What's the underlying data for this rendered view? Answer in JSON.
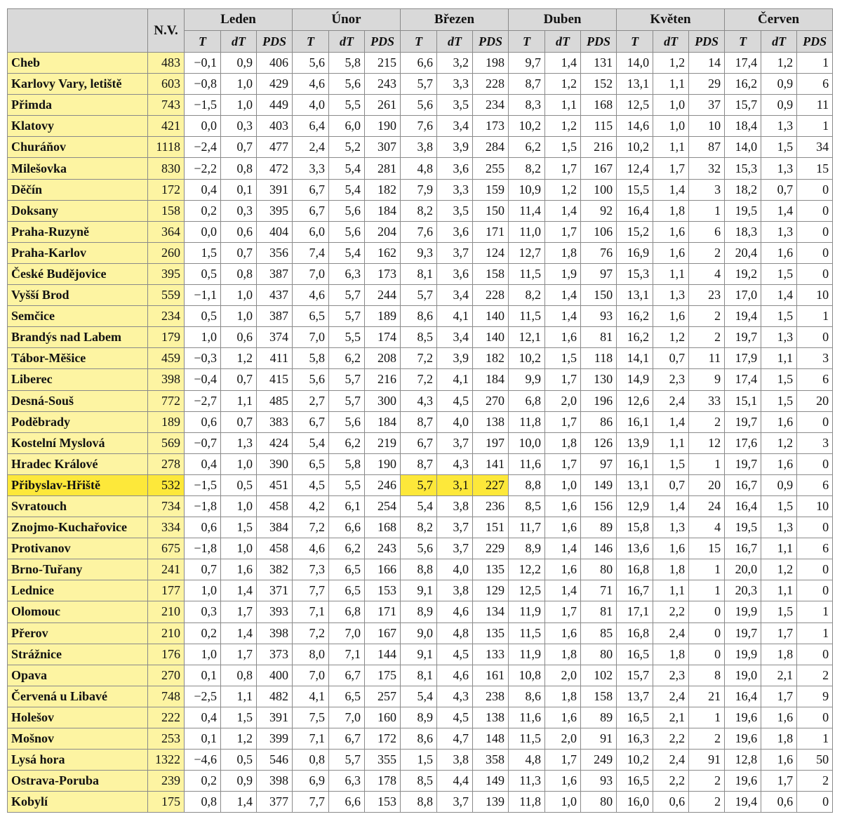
{
  "table": {
    "nv_header": "N.V.",
    "months": [
      "Leden",
      "Únor",
      "Březen",
      "Duben",
      "Květen",
      "Červen"
    ],
    "sub_headers": [
      "T",
      "dT",
      "PDS"
    ],
    "highlight": {
      "row": 20,
      "month_index": 2
    },
    "colors": {
      "station_bg": "#fdf4a2",
      "highlight_bg": "#fde83a",
      "header_bg": "#d9d9d9"
    },
    "rows": [
      [
        "Cheb",
        "483",
        "−0,1",
        "0,9",
        "406",
        "5,6",
        "5,8",
        "215",
        "6,6",
        "3,2",
        "198",
        "9,7",
        "1,4",
        "131",
        "14,0",
        "1,2",
        "14",
        "17,4",
        "1,2",
        "1"
      ],
      [
        "Karlovy Vary, letiště",
        "603",
        "−0,8",
        "1,0",
        "429",
        "4,6",
        "5,6",
        "243",
        "5,7",
        "3,3",
        "228",
        "8,7",
        "1,2",
        "152",
        "13,1",
        "1,1",
        "29",
        "16,2",
        "0,9",
        "6"
      ],
      [
        "Přimda",
        "743",
        "−1,5",
        "1,0",
        "449",
        "4,0",
        "5,5",
        "261",
        "5,6",
        "3,5",
        "234",
        "8,3",
        "1,1",
        "168",
        "12,5",
        "1,0",
        "37",
        "15,7",
        "0,9",
        "11"
      ],
      [
        "Klatovy",
        "421",
        "0,0",
        "0,3",
        "403",
        "6,4",
        "6,0",
        "190",
        "7,6",
        "3,4",
        "173",
        "10,2",
        "1,2",
        "115",
        "14,6",
        "1,0",
        "10",
        "18,4",
        "1,3",
        "1"
      ],
      [
        "Churáňov",
        "1118",
        "−2,4",
        "0,7",
        "477",
        "2,4",
        "5,2",
        "307",
        "3,8",
        "3,9",
        "284",
        "6,2",
        "1,5",
        "216",
        "10,2",
        "1,1",
        "87",
        "14,0",
        "1,5",
        "34"
      ],
      [
        "Milešovka",
        "830",
        "−2,2",
        "0,8",
        "472",
        "3,3",
        "5,4",
        "281",
        "4,8",
        "3,6",
        "255",
        "8,2",
        "1,7",
        "167",
        "12,4",
        "1,7",
        "32",
        "15,3",
        "1,3",
        "15"
      ],
      [
        "Děčín",
        "172",
        "0,4",
        "0,1",
        "391",
        "6,7",
        "5,4",
        "182",
        "7,9",
        "3,3",
        "159",
        "10,9",
        "1,2",
        "100",
        "15,5",
        "1,4",
        "3",
        "18,2",
        "0,7",
        "0"
      ],
      [
        "Doksany",
        "158",
        "0,2",
        "0,3",
        "395",
        "6,7",
        "5,6",
        "184",
        "8,2",
        "3,5",
        "150",
        "11,4",
        "1,4",
        "92",
        "16,4",
        "1,8",
        "1",
        "19,5",
        "1,4",
        "0"
      ],
      [
        "Praha-Ruzyně",
        "364",
        "0,0",
        "0,6",
        "404",
        "6,0",
        "5,6",
        "204",
        "7,6",
        "3,6",
        "171",
        "11,0",
        "1,7",
        "106",
        "15,2",
        "1,6",
        "6",
        "18,3",
        "1,3",
        "0"
      ],
      [
        "Praha-Karlov",
        "260",
        "1,5",
        "0,7",
        "356",
        "7,4",
        "5,4",
        "162",
        "9,3",
        "3,7",
        "124",
        "12,7",
        "1,8",
        "76",
        "16,9",
        "1,6",
        "2",
        "20,4",
        "1,6",
        "0"
      ],
      [
        "České Budějovice",
        "395",
        "0,5",
        "0,8",
        "387",
        "7,0",
        "6,3",
        "173",
        "8,1",
        "3,6",
        "158",
        "11,5",
        "1,9",
        "97",
        "15,3",
        "1,1",
        "4",
        "19,2",
        "1,5",
        "0"
      ],
      [
        "Vyšší Brod",
        "559",
        "−1,1",
        "1,0",
        "437",
        "4,6",
        "5,7",
        "244",
        "5,7",
        "3,4",
        "228",
        "8,2",
        "1,4",
        "150",
        "13,1",
        "1,3",
        "23",
        "17,0",
        "1,4",
        "10"
      ],
      [
        "Semčice",
        "234",
        "0,5",
        "1,0",
        "387",
        "6,5",
        "5,7",
        "189",
        "8,6",
        "4,1",
        "140",
        "11,5",
        "1,4",
        "93",
        "16,2",
        "1,6",
        "2",
        "19,4",
        "1,5",
        "1"
      ],
      [
        "Brandýs nad Labem",
        "179",
        "1,0",
        "0,6",
        "374",
        "7,0",
        "5,5",
        "174",
        "8,5",
        "3,4",
        "140",
        "12,1",
        "1,6",
        "81",
        "16,2",
        "1,2",
        "2",
        "19,7",
        "1,3",
        "0"
      ],
      [
        "Tábor-Měšice",
        "459",
        "−0,3",
        "1,2",
        "411",
        "5,8",
        "6,2",
        "208",
        "7,2",
        "3,9",
        "182",
        "10,2",
        "1,5",
        "118",
        "14,1",
        "0,7",
        "11",
        "17,9",
        "1,1",
        "3"
      ],
      [
        "Liberec",
        "398",
        "−0,4",
        "0,7",
        "415",
        "5,6",
        "5,7",
        "216",
        "7,2",
        "4,1",
        "184",
        "9,9",
        "1,7",
        "130",
        "14,9",
        "2,3",
        "9",
        "17,4",
        "1,5",
        "6"
      ],
      [
        "Desná-Souš",
        "772",
        "−2,7",
        "1,1",
        "485",
        "2,7",
        "5,7",
        "300",
        "4,3",
        "4,5",
        "270",
        "6,8",
        "2,0",
        "196",
        "12,6",
        "2,4",
        "33",
        "15,1",
        "1,5",
        "20"
      ],
      [
        "Poděbrady",
        "189",
        "0,6",
        "0,7",
        "383",
        "6,7",
        "5,6",
        "184",
        "8,7",
        "4,0",
        "138",
        "11,8",
        "1,7",
        "86",
        "16,1",
        "1,4",
        "2",
        "19,7",
        "1,6",
        "0"
      ],
      [
        "Kostelní Myslová",
        "569",
        "−0,7",
        "1,3",
        "424",
        "5,4",
        "6,2",
        "219",
        "6,7",
        "3,7",
        "197",
        "10,0",
        "1,8",
        "126",
        "13,9",
        "1,1",
        "12",
        "17,6",
        "1,2",
        "3"
      ],
      [
        "Hradec Králové",
        "278",
        "0,4",
        "1,0",
        "390",
        "6,5",
        "5,8",
        "190",
        "8,7",
        "4,3",
        "141",
        "11,6",
        "1,7",
        "97",
        "16,1",
        "1,5",
        "1",
        "19,7",
        "1,6",
        "0"
      ],
      [
        "Přibyslav-Hřiště",
        "532",
        "−1,5",
        "0,5",
        "451",
        "4,5",
        "5,5",
        "246",
        "5,7",
        "3,1",
        "227",
        "8,8",
        "1,0",
        "149",
        "13,1",
        "0,7",
        "20",
        "16,7",
        "0,9",
        "6"
      ],
      [
        "Svratouch",
        "734",
        "−1,8",
        "1,0",
        "458",
        "4,2",
        "6,1",
        "254",
        "5,4",
        "3,8",
        "236",
        "8,5",
        "1,6",
        "156",
        "12,9",
        "1,4",
        "24",
        "16,4",
        "1,5",
        "10"
      ],
      [
        "Znojmo-Kuchařovice",
        "334",
        "0,6",
        "1,5",
        "384",
        "7,2",
        "6,6",
        "168",
        "8,2",
        "3,7",
        "151",
        "11,7",
        "1,6",
        "89",
        "15,8",
        "1,3",
        "4",
        "19,5",
        "1,3",
        "0"
      ],
      [
        "Protivanov",
        "675",
        "−1,8",
        "1,0",
        "458",
        "4,6",
        "6,2",
        "243",
        "5,6",
        "3,7",
        "229",
        "8,9",
        "1,4",
        "146",
        "13,6",
        "1,6",
        "15",
        "16,7",
        "1,1",
        "6"
      ],
      [
        "Brno-Tuřany",
        "241",
        "0,7",
        "1,6",
        "382",
        "7,3",
        "6,5",
        "166",
        "8,8",
        "4,0",
        "135",
        "12,2",
        "1,6",
        "80",
        "16,8",
        "1,8",
        "1",
        "20,0",
        "1,2",
        "0"
      ],
      [
        "Lednice",
        "177",
        "1,0",
        "1,4",
        "371",
        "7,7",
        "6,5",
        "153",
        "9,1",
        "3,8",
        "129",
        "12,5",
        "1,4",
        "71",
        "16,7",
        "1,1",
        "1",
        "20,3",
        "1,1",
        "0"
      ],
      [
        "Olomouc",
        "210",
        "0,3",
        "1,7",
        "393",
        "7,1",
        "6,8",
        "171",
        "8,9",
        "4,6",
        "134",
        "11,9",
        "1,7",
        "81",
        "17,1",
        "2,2",
        "0",
        "19,9",
        "1,5",
        "1"
      ],
      [
        "Přerov",
        "210",
        "0,2",
        "1,4",
        "398",
        "7,2",
        "7,0",
        "167",
        "9,0",
        "4,8",
        "135",
        "11,5",
        "1,6",
        "85",
        "16,8",
        "2,4",
        "0",
        "19,7",
        "1,7",
        "1"
      ],
      [
        "Strážnice",
        "176",
        "1,0",
        "1,7",
        "373",
        "8,0",
        "7,1",
        "144",
        "9,1",
        "4,5",
        "133",
        "11,9",
        "1,8",
        "80",
        "16,5",
        "1,8",
        "0",
        "19,9",
        "1,8",
        "0"
      ],
      [
        "Opava",
        "270",
        "0,1",
        "0,8",
        "400",
        "7,0",
        "6,7",
        "175",
        "8,1",
        "4,6",
        "161",
        "10,8",
        "2,0",
        "102",
        "15,7",
        "2,3",
        "8",
        "19,0",
        "2,1",
        "2"
      ],
      [
        "Červená u Libavé",
        "748",
        "−2,5",
        "1,1",
        "482",
        "4,1",
        "6,5",
        "257",
        "5,4",
        "4,3",
        "238",
        "8,6",
        "1,8",
        "158",
        "13,7",
        "2,4",
        "21",
        "16,4",
        "1,7",
        "9"
      ],
      [
        "Holešov",
        "222",
        "0,4",
        "1,5",
        "391",
        "7,5",
        "7,0",
        "160",
        "8,9",
        "4,5",
        "138",
        "11,6",
        "1,6",
        "89",
        "16,5",
        "2,1",
        "1",
        "19,6",
        "1,6",
        "0"
      ],
      [
        "Mošnov",
        "253",
        "0,1",
        "1,2",
        "399",
        "7,1",
        "6,7",
        "172",
        "8,6",
        "4,7",
        "148",
        "11,5",
        "2,0",
        "91",
        "16,3",
        "2,2",
        "2",
        "19,6",
        "1,8",
        "1"
      ],
      [
        "Lysá hora",
        "1322",
        "−4,6",
        "0,5",
        "546",
        "0,8",
        "5,7",
        "355",
        "1,5",
        "3,8",
        "358",
        "4,8",
        "1,7",
        "249",
        "10,2",
        "2,4",
        "91",
        "12,8",
        "1,6",
        "50"
      ],
      [
        "Ostrava-Poruba",
        "239",
        "0,2",
        "0,9",
        "398",
        "6,9",
        "6,3",
        "178",
        "8,5",
        "4,4",
        "149",
        "11,3",
        "1,6",
        "93",
        "16,5",
        "2,2",
        "2",
        "19,6",
        "1,7",
        "2"
      ],
      [
        "Kobylí",
        "175",
        "0,8",
        "1,4",
        "377",
        "7,7",
        "6,6",
        "153",
        "8,8",
        "3,7",
        "139",
        "11,8",
        "1,0",
        "80",
        "16,0",
        "0,6",
        "2",
        "19,4",
        "0,6",
        "0"
      ]
    ]
  }
}
